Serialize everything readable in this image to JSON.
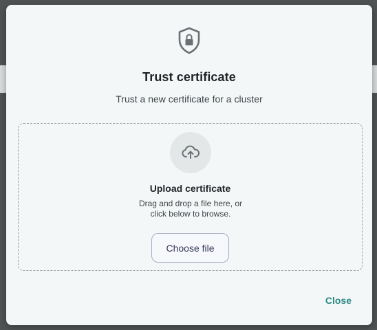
{
  "modal": {
    "icon": "shield-lock-icon",
    "title": "Trust certificate",
    "subtitle": "Trust a new certificate for a cluster",
    "upload": {
      "icon": "cloud-upload-icon",
      "title": "Upload certificate",
      "hint_line1": "Drag and drop a file here, or",
      "hint_line2": "click below to browse.",
      "button_label": "Choose file"
    },
    "close_label": "Close"
  },
  "colors": {
    "modal_bg": "#f4f7f7",
    "overlay": "#4f5353",
    "accent_teal": "#2a8a85",
    "button_border": "#a9acc6",
    "icon_gray": "#6b7074"
  }
}
